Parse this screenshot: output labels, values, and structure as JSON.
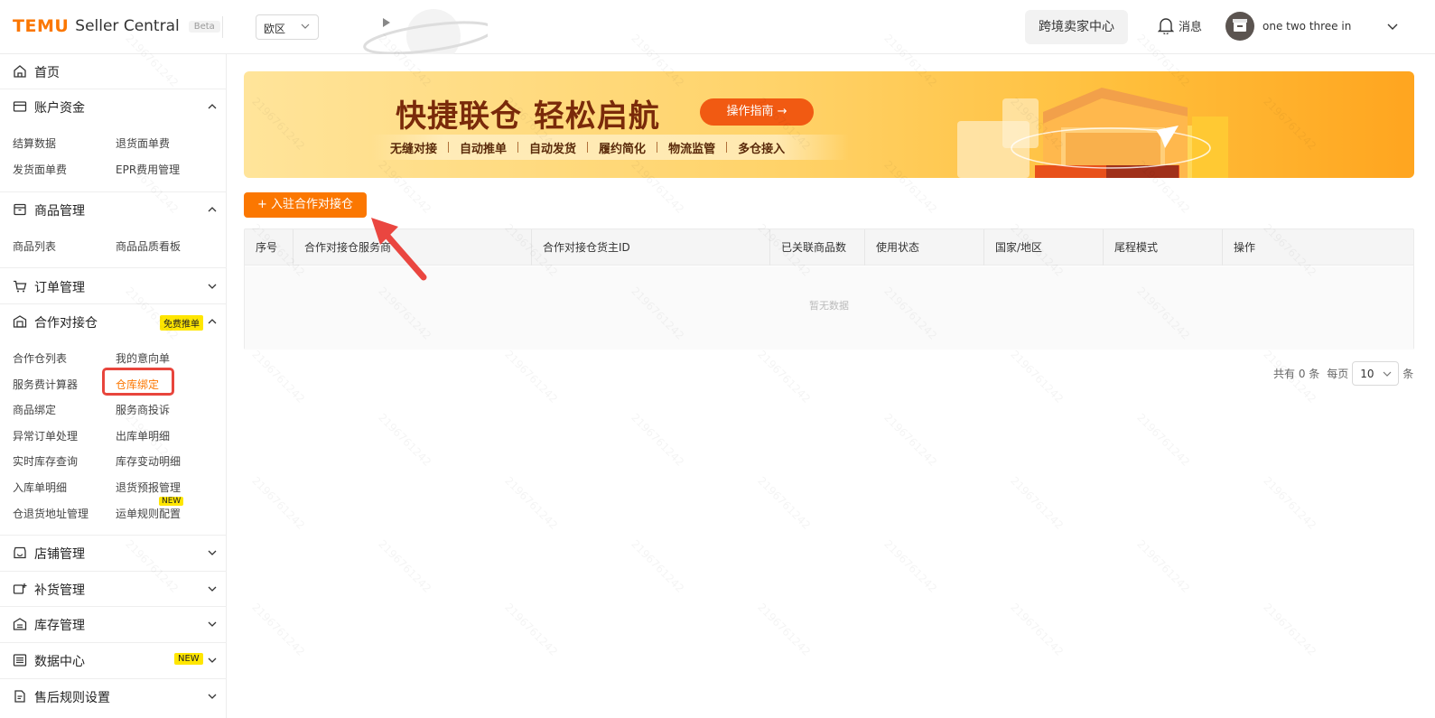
{
  "header": {
    "brand": "TEMU",
    "product": "Seller Central",
    "badge": "Beta",
    "region": "欧区",
    "cross_border_btn": "跨境卖家中心",
    "messages": "消息",
    "username": "one two three in"
  },
  "sidebar": {
    "home": "首页",
    "account": {
      "label": "账户资金",
      "items": [
        "结算数据",
        "退货面单费",
        "发货面单费",
        "EPR费用管理"
      ]
    },
    "product": {
      "label": "商品管理",
      "items": [
        "商品列表",
        "商品品质看板"
      ]
    },
    "order": {
      "label": "订单管理"
    },
    "warehouse": {
      "label": "合作对接仓",
      "tag": "免费推单",
      "items": [
        "合作仓列表",
        "我的意向单",
        "服务费计算器",
        "仓库绑定",
        "商品绑定",
        "服务商投诉",
        "异常订单处理",
        "出库单明细",
        "实时库存查询",
        "库存变动明细",
        "入库单明细",
        "退货预报管理",
        "仓退货地址管理",
        "运单规则配置"
      ],
      "new_tag": "NEW"
    },
    "store": {
      "label": "店铺管理"
    },
    "replenish": {
      "label": "补货管理"
    },
    "inventory": {
      "label": "库存管理"
    },
    "data_center": {
      "label": "数据中心",
      "tag": "NEW"
    },
    "aftersale": {
      "label": "售后规则设置"
    }
  },
  "banner": {
    "title": "快捷联仓 轻松启航",
    "button": "操作指南 →",
    "features": [
      "无缝对接",
      "自动推单",
      "自动发货",
      "履约简化",
      "物流监管",
      "多仓接入"
    ]
  },
  "main": {
    "add_button": "+ 入驻合作对接仓",
    "columns": [
      "序号",
      "合作对接仓服务商",
      "合作对接仓货主ID",
      "已关联商品数",
      "使用状态",
      "国家/地区",
      "尾程模式",
      "操作"
    ],
    "empty": "暂无数据",
    "pager": {
      "total": "共有 0 条",
      "per_page": "每页",
      "size": "10",
      "unit": "条"
    }
  },
  "watermark": "2196761242"
}
